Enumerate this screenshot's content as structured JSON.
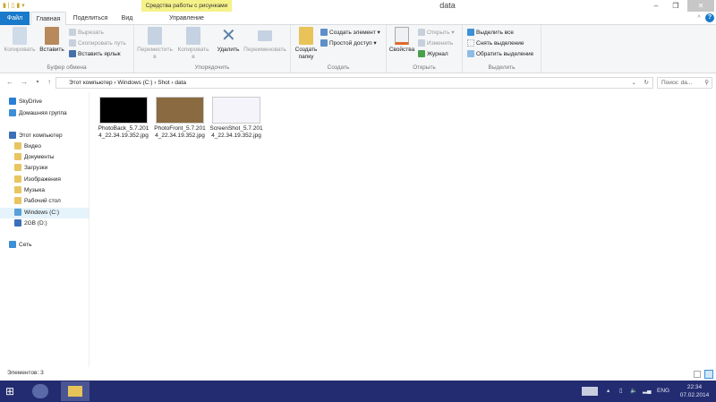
{
  "window": {
    "title": "data",
    "context_tab": "Средства работы с рисунками",
    "minimize": "–",
    "maximize": "❐",
    "close": "✕"
  },
  "tabs": [
    {
      "label": "Файл"
    },
    {
      "label": "Главная"
    },
    {
      "label": "Поделиться"
    },
    {
      "label": "Вид"
    },
    {
      "label": "Управление"
    }
  ],
  "ribbon": {
    "clipboard": {
      "label": "Буфер обмена",
      "copy": "Копировать",
      "paste": "Вставить",
      "cut": "Вырезать",
      "copy_path": "Скопировать путь",
      "paste_shortcut": "Вставить ярлык"
    },
    "organize": {
      "label": "Упорядочить",
      "move": "Переместить в",
      "copy_to": "Копировать в",
      "delete": "Удалить",
      "rename": "Переименовать"
    },
    "create": {
      "label": "Создать",
      "new_folder": "Создать папку",
      "new_item": "Создать элемент ▾",
      "easy_access": "Простой доступ ▾"
    },
    "open": {
      "label": "Открыть",
      "properties": "Свойства",
      "open": "Открыть ▾",
      "edit": "Изменить",
      "history": "Журнал"
    },
    "select": {
      "label": "Выделить",
      "select_all": "Выделить все",
      "select_none": "Снять выделение",
      "invert": "Обратить выделение"
    }
  },
  "address": {
    "path": [
      "Этот компьютер",
      "Windows (C:)",
      "Shot",
      "data"
    ],
    "search_placeholder": "Поиск: da..."
  },
  "nav": [
    {
      "label": "SkyDrive",
      "color": "#2a7fd4"
    },
    {
      "label": "Домашняя группа",
      "color": "#3d8fd6"
    },
    {
      "label": "Этот компьютер",
      "color": "#3b6fb8"
    },
    {
      "label": "Видео",
      "color": "#e8c560"
    },
    {
      "label": "Документы",
      "color": "#e8c560"
    },
    {
      "label": "Загрузки",
      "color": "#e8c560"
    },
    {
      "label": "Изображения",
      "color": "#e8c560"
    },
    {
      "label": "Музыка",
      "color": "#e8c560"
    },
    {
      "label": "Рабочий стол",
      "color": "#e8c560"
    },
    {
      "label": "Windows (C:)",
      "color": "#5aa0d8",
      "selected": true
    },
    {
      "label": "2GB (D:)",
      "color": "#3b6fb8"
    },
    {
      "label": "Сеть",
      "color": "#3d8fd6"
    }
  ],
  "files": [
    {
      "name": "PhotoBack_5.7.2014_22.34.19.352.jpg",
      "thumb": "#000000"
    },
    {
      "name": "PhotoFront_5.7.2014_22.34.19.352.jpg",
      "thumb": "#8a6a40"
    },
    {
      "name": "ScreenShot_5.7.2014_22.34.19.352.jpg",
      "thumb": "#f4f4fa"
    }
  ],
  "status": {
    "count": "Элементов: 3"
  },
  "taskbar": {
    "lang": "ENG",
    "time": "22:34",
    "date": "07.02.2014",
    "color": "#232c70"
  }
}
